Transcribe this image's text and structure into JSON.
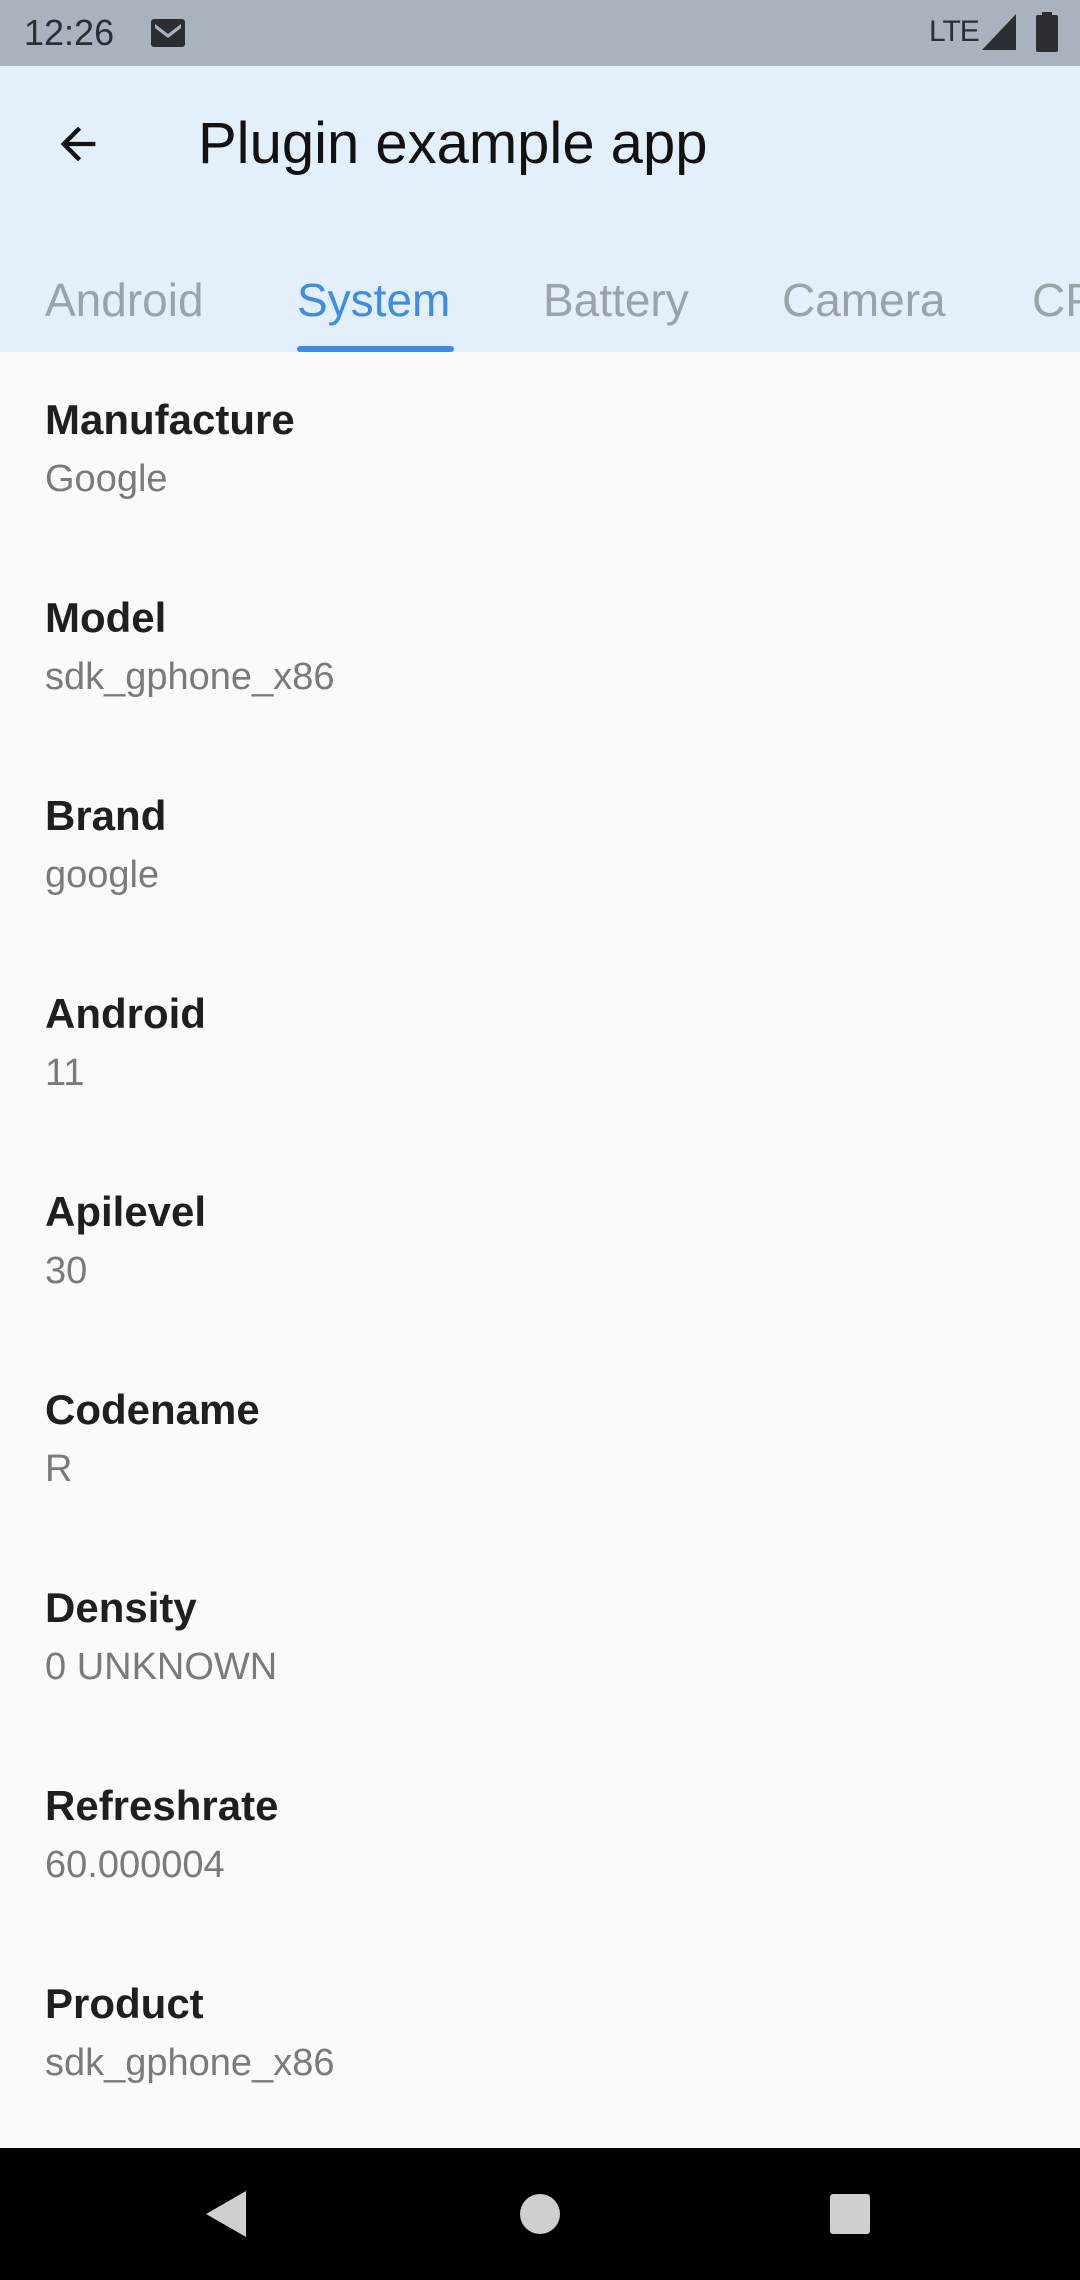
{
  "status_bar": {
    "time": "12:26",
    "network": "LTE",
    "icons": [
      "mail-icon",
      "signal-icon",
      "battery-icon"
    ]
  },
  "app_bar": {
    "title": "Plugin example app",
    "back_icon": "arrow-back-icon",
    "background": "#e3f0fb"
  },
  "tabs": [
    {
      "label": "Android",
      "active": false
    },
    {
      "label": "System",
      "active": true
    },
    {
      "label": "Battery",
      "active": false
    },
    {
      "label": "Camera",
      "active": false
    },
    {
      "label": "CPU",
      "active": false
    }
  ],
  "accent_color": "#3d8ce8",
  "items": [
    {
      "label": "Manufacture",
      "value": "Google"
    },
    {
      "label": "Model",
      "value": "sdk_gphone_x86"
    },
    {
      "label": "Brand",
      "value": "google"
    },
    {
      "label": "Android",
      "value": "11"
    },
    {
      "label": "Apilevel",
      "value": "30"
    },
    {
      "label": "Codename",
      "value": "R"
    },
    {
      "label": "Density",
      "value": "0 UNKNOWN"
    },
    {
      "label": "Refreshrate",
      "value": "60.000004"
    },
    {
      "label": "Product",
      "value": "sdk_gphone_x86"
    }
  ],
  "nav_bar": {
    "buttons": [
      "back-triangle-icon",
      "home-circle-icon",
      "recents-square-icon"
    ]
  }
}
